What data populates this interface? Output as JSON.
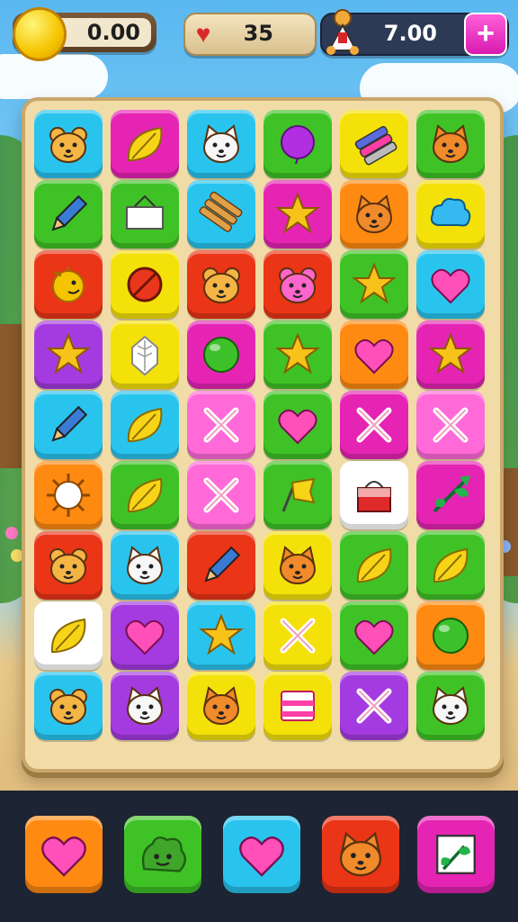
{
  "hud": {
    "coins": "0.00",
    "lives": "35",
    "money": "7.00",
    "plus_label": "+"
  },
  "colors": {
    "cyan": "#29c4ee",
    "magenta": "#e524b4",
    "green": "#3fc226",
    "yellow": "#f4e10a",
    "orange": "#ff8a12",
    "red": "#ea3517",
    "purple": "#a43be0",
    "pink": "#ff6ad8",
    "white": "#ffffff"
  },
  "board": {
    "rows": [
      [
        {
          "bg": "cyan",
          "icon": "bear-face-icon"
        },
        {
          "bg": "magenta",
          "icon": "leaf-icon"
        },
        {
          "bg": "cyan",
          "icon": "cat-face-icon"
        },
        {
          "bg": "green",
          "icon": "balloon-icon"
        },
        {
          "bg": "yellow",
          "icon": "crayon-box-icon"
        },
        {
          "bg": "green",
          "icon": "fox-face-icon"
        }
      ],
      [
        {
          "bg": "green",
          "icon": "pencil-icon"
        },
        {
          "bg": "green",
          "icon": "sign-board-icon"
        },
        {
          "bg": "cyan",
          "icon": "log-stack-icon"
        },
        {
          "bg": "magenta",
          "icon": "star-icon"
        },
        {
          "bg": "orange",
          "icon": "fox-face-icon"
        },
        {
          "bg": "yellow",
          "icon": "cloud-icon"
        }
      ],
      [
        {
          "bg": "red",
          "icon": "sun-face-icon"
        },
        {
          "bg": "yellow",
          "icon": "no-sign-icon"
        },
        {
          "bg": "red",
          "icon": "bear-face-icon"
        },
        {
          "bg": "red",
          "icon": "pig-face-icon"
        },
        {
          "bg": "green",
          "icon": "star-icon"
        },
        {
          "bg": "cyan",
          "icon": "heart-icon"
        }
      ],
      [
        {
          "bg": "purple",
          "icon": "star-icon"
        },
        {
          "bg": "yellow",
          "icon": "leaf-outline-icon"
        },
        {
          "bg": "magenta",
          "icon": "ball-icon"
        },
        {
          "bg": "green",
          "icon": "star-icon"
        },
        {
          "bg": "orange",
          "icon": "heart-icon"
        },
        {
          "bg": "magenta",
          "icon": "star-icon"
        }
      ],
      [
        {
          "bg": "cyan",
          "icon": "pencil-icon"
        },
        {
          "bg": "cyan",
          "icon": "leaf-icon"
        },
        {
          "bg": "pink",
          "icon": "cross-icon"
        },
        {
          "bg": "green",
          "icon": "heart-icon"
        },
        {
          "bg": "magenta",
          "icon": "cross-icon"
        },
        {
          "bg": "pink",
          "icon": "cross-icon"
        }
      ],
      [
        {
          "bg": "orange",
          "icon": "sun-icon"
        },
        {
          "bg": "green",
          "icon": "leaf-icon"
        },
        {
          "bg": "pink",
          "icon": "cross-icon"
        },
        {
          "bg": "green",
          "icon": "flag-icon"
        },
        {
          "bg": "white",
          "icon": "bag-icon"
        },
        {
          "bg": "magenta",
          "icon": "plant-icon"
        }
      ],
      [
        {
          "bg": "red",
          "icon": "bear-face-icon"
        },
        {
          "bg": "cyan",
          "icon": "cat-face-icon"
        },
        {
          "bg": "red",
          "icon": "pencil-icon"
        },
        {
          "bg": "yellow",
          "icon": "fox-face-icon"
        },
        {
          "bg": "green",
          "icon": "leaf-icon"
        },
        {
          "bg": "green",
          "icon": "leaf-icon"
        }
      ],
      [
        {
          "bg": "white",
          "icon": "leaf-icon"
        },
        {
          "bg": "purple",
          "icon": "heart-icon"
        },
        {
          "bg": "cyan",
          "icon": "star-icon"
        },
        {
          "bg": "yellow",
          "icon": "cross-icon"
        },
        {
          "bg": "green",
          "icon": "heart-icon"
        },
        {
          "bg": "orange",
          "icon": "ball-icon"
        }
      ],
      [
        {
          "bg": "cyan",
          "icon": "bear-face-icon"
        },
        {
          "bg": "purple",
          "icon": "cat-face-icon"
        },
        {
          "bg": "yellow",
          "icon": "fox-face-icon"
        },
        {
          "bg": "yellow",
          "icon": "gift-box-icon"
        },
        {
          "bg": "purple",
          "icon": "cross-icon"
        },
        {
          "bg": "green",
          "icon": "cat-face-icon"
        }
      ]
    ]
  },
  "tray": {
    "slots": [
      {
        "bg": "orange",
        "icon": "heart-icon"
      },
      {
        "bg": "green",
        "icon": "slime-face-icon"
      },
      {
        "bg": "cyan",
        "icon": "heart-icon"
      },
      {
        "bg": "red",
        "icon": "fox-face-icon"
      },
      {
        "bg": "magenta",
        "icon": "plant-card-icon"
      }
    ]
  }
}
